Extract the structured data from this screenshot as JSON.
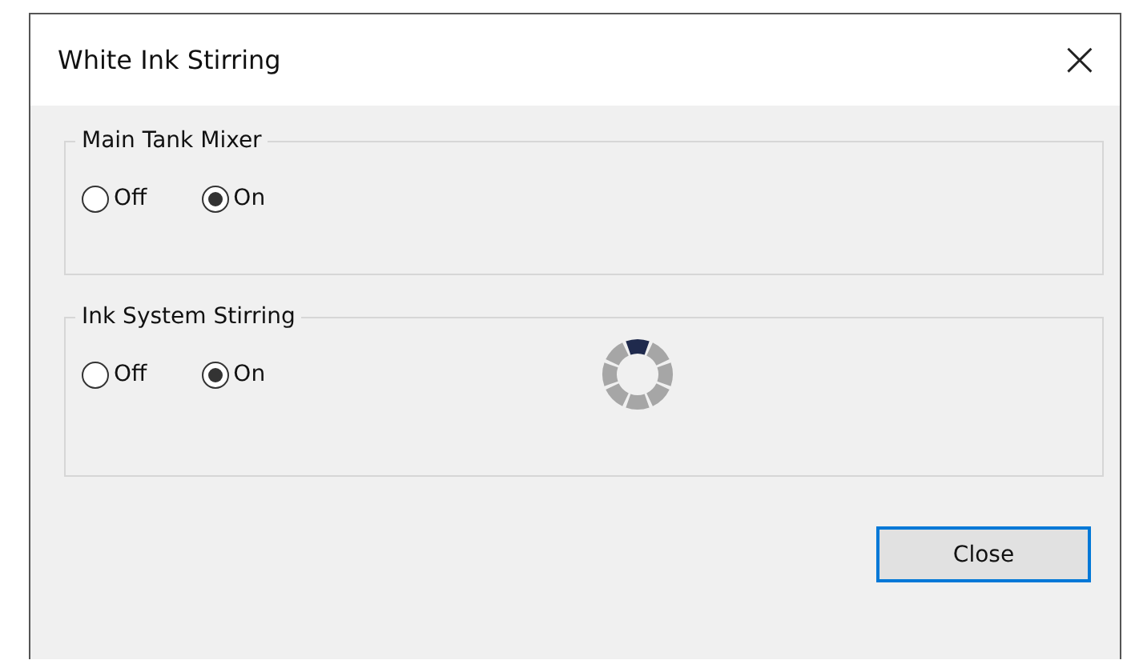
{
  "window": {
    "title": "White Ink Stirring",
    "close_glyph": "×"
  },
  "groups": [
    {
      "title": "Main Tank Mixer",
      "busy": false,
      "options": [
        {
          "label": "Off",
          "selected": false
        },
        {
          "label": "On",
          "selected": true
        }
      ]
    },
    {
      "title": "Ink System Stirring",
      "busy": true,
      "options": [
        {
          "label": "Off",
          "selected": false
        },
        {
          "label": "On",
          "selected": true
        }
      ]
    }
  ],
  "buttons": [
    "Close"
  ]
}
